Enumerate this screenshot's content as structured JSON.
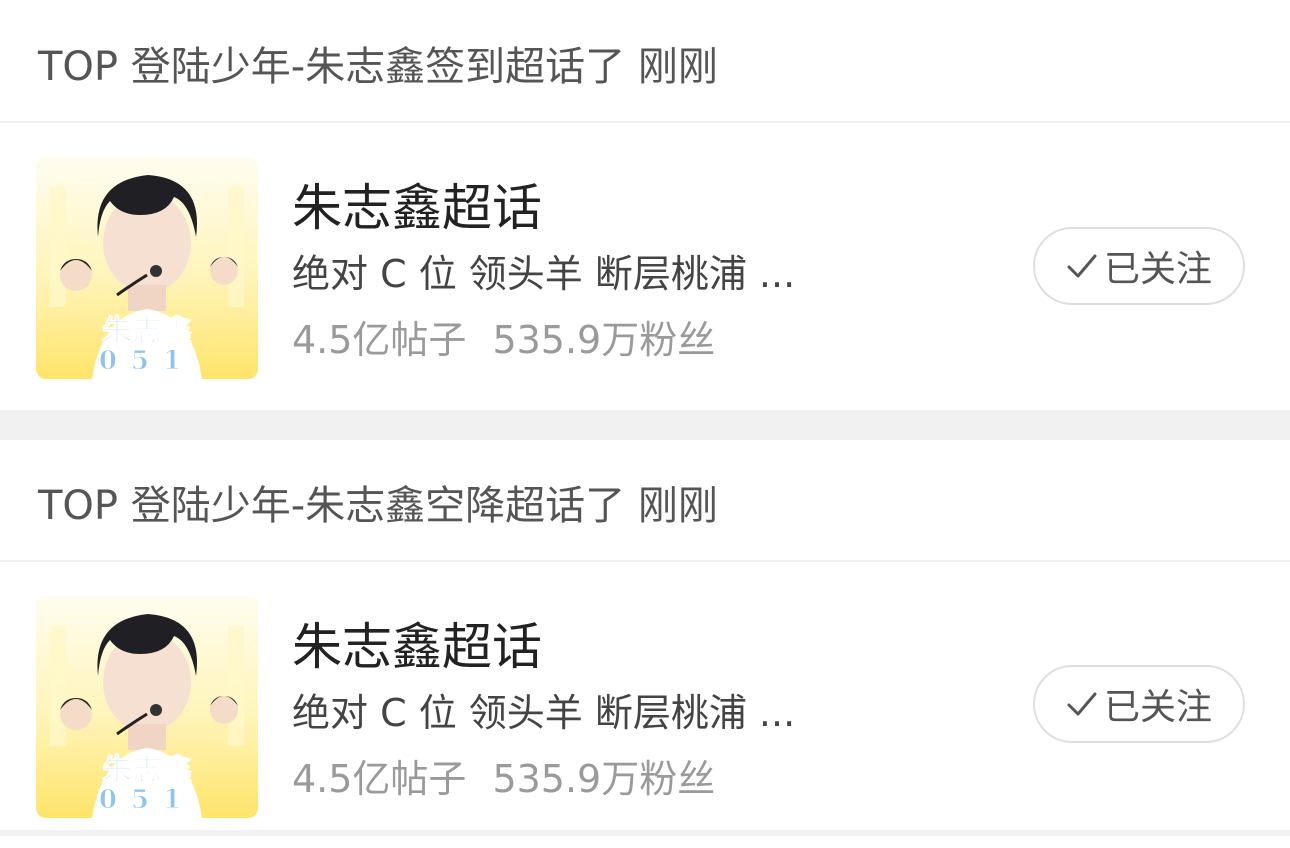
{
  "feed": [
    {
      "activity": "TOP 登陆少年-朱志鑫签到超话了 刚刚",
      "topic": {
        "avatar_label": "朱志鑫",
        "avatar_number": "051",
        "title": "朱志鑫超话",
        "description": "绝对 C 位 领头羊 断层桃浦 ...",
        "posts": "4.5亿帖子",
        "fans": "535.9万粉丝",
        "follow_label": "已关注",
        "follow_icon": "checkmark-icon"
      }
    },
    {
      "activity": "TOP 登陆少年-朱志鑫空降超话了 刚刚",
      "topic": {
        "avatar_label": "朱志鑫",
        "avatar_number": "051",
        "title": "朱志鑫超话",
        "description": "绝对 C 位 领头羊 断层桃浦 ...",
        "posts": "4.5亿帖子",
        "fans": "535.9万粉丝",
        "follow_label": "已关注",
        "follow_icon": "checkmark-icon"
      }
    }
  ]
}
